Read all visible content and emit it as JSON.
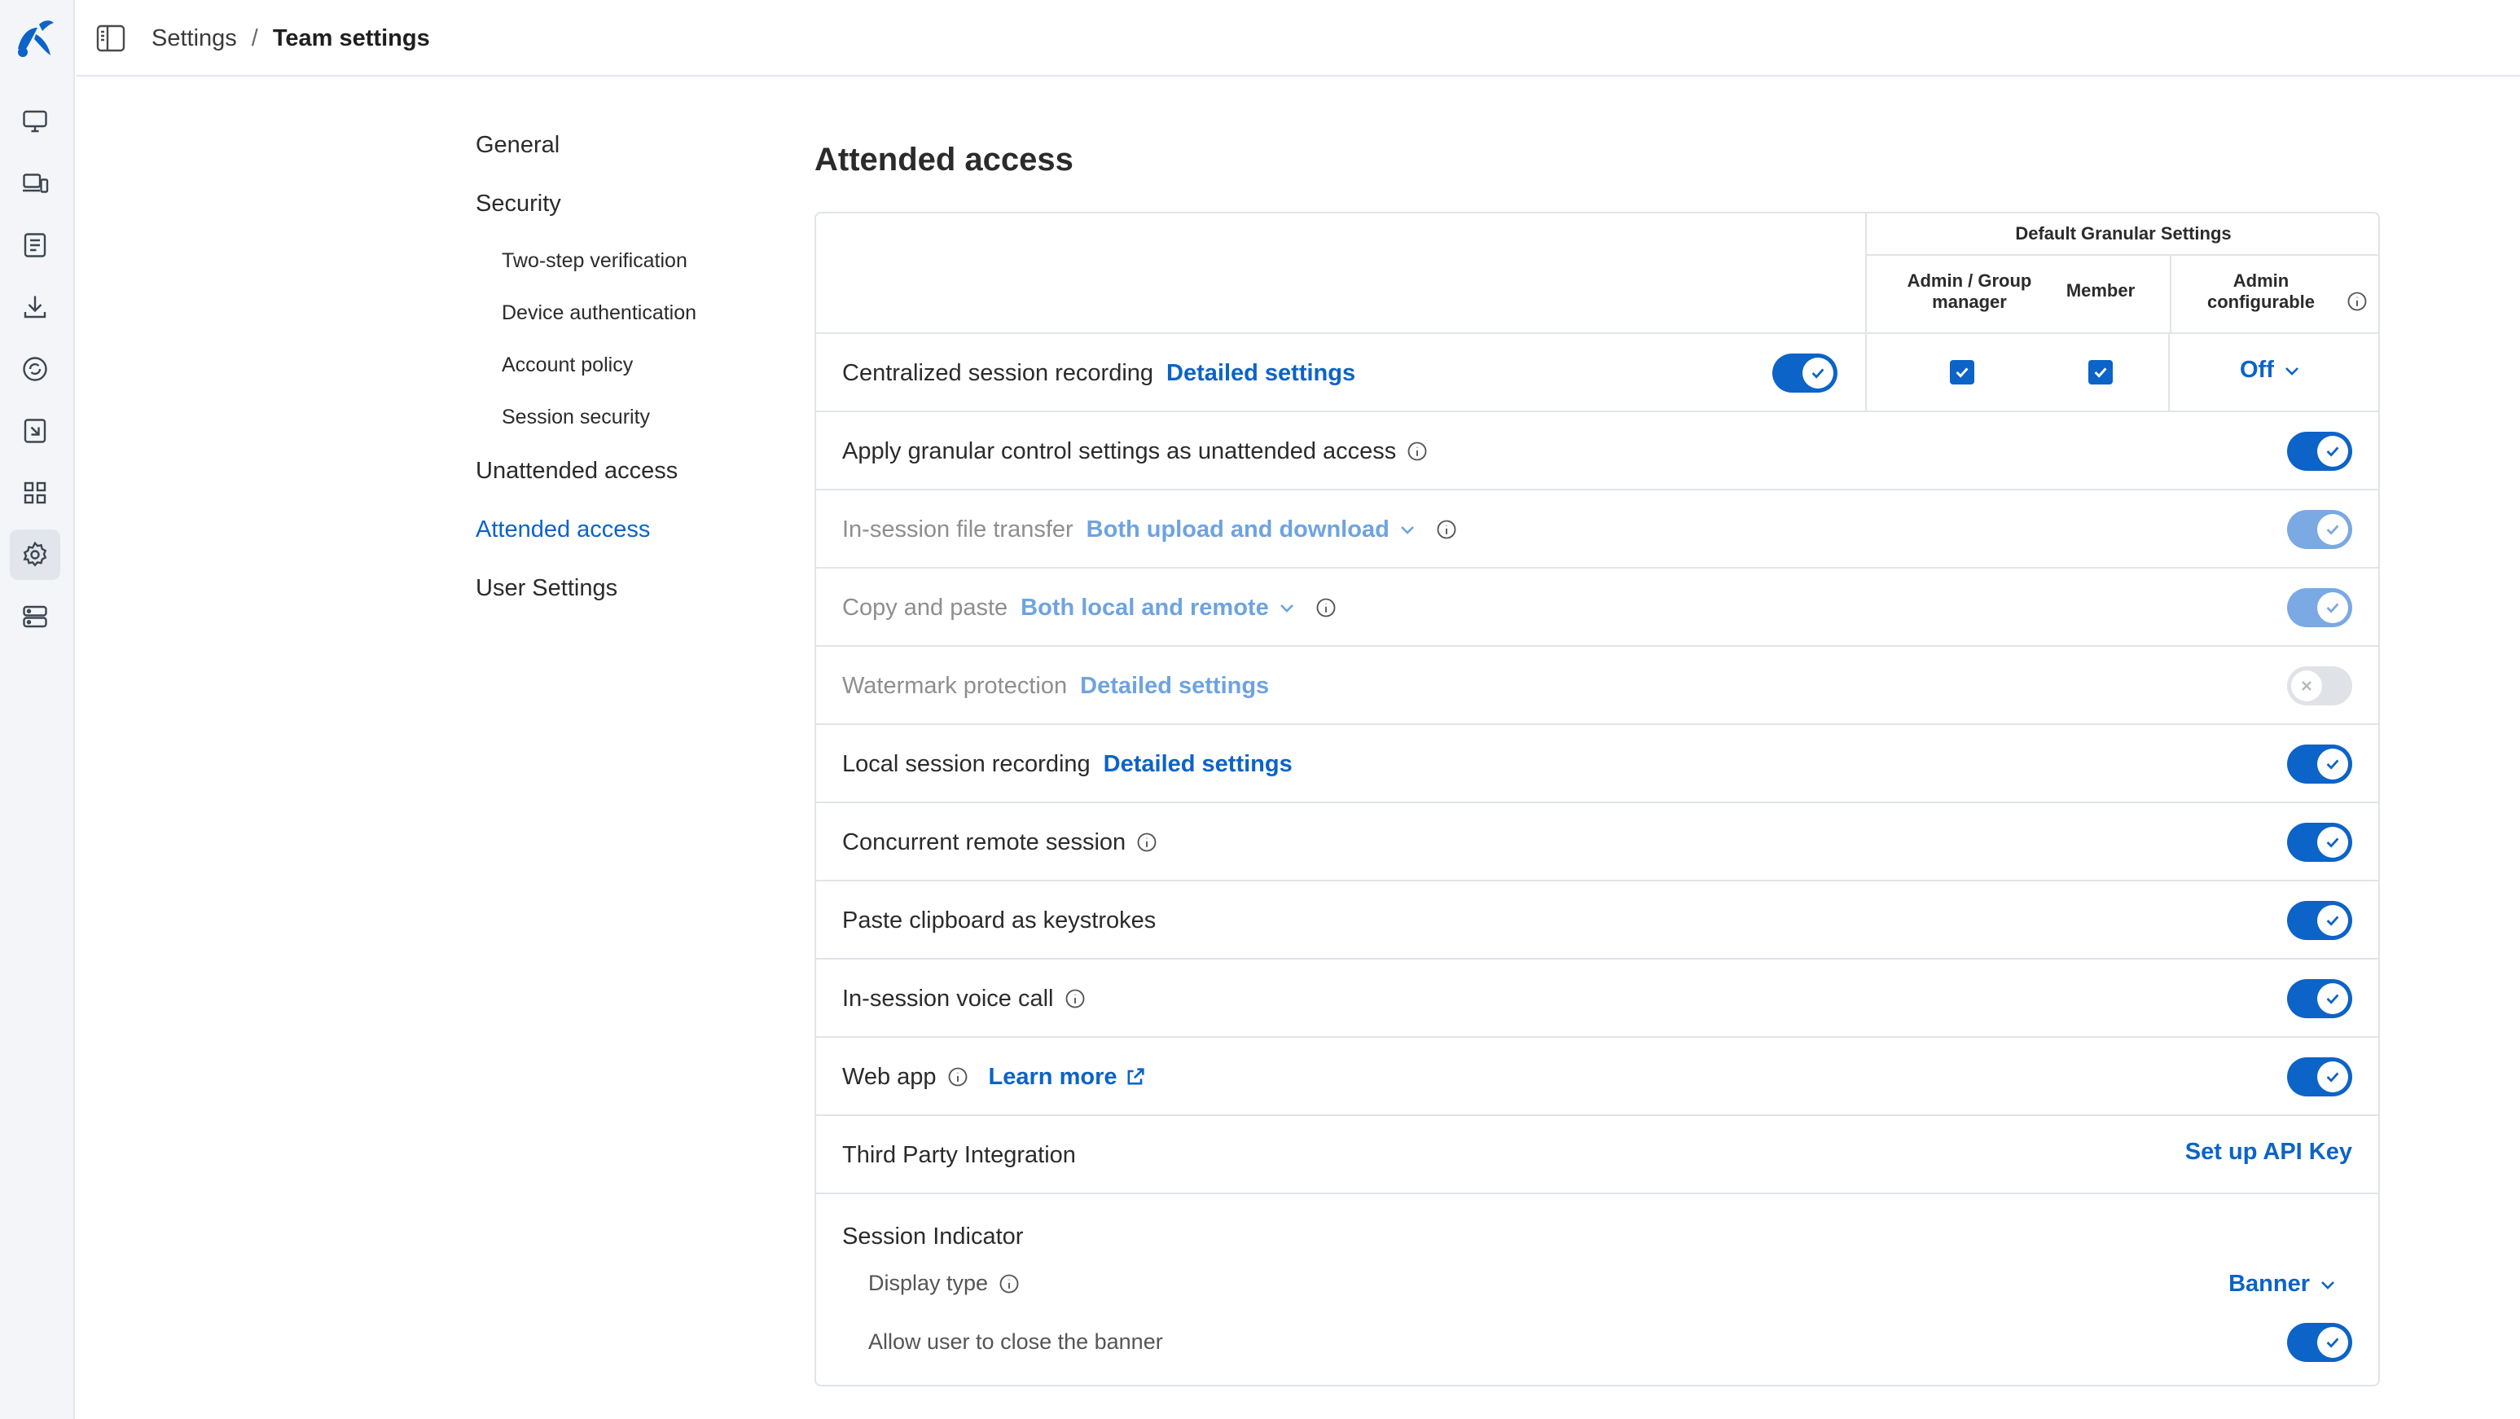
{
  "app": {
    "brand_color": "#0c63c8"
  },
  "rail": {
    "icons": [
      "monitor-icon",
      "devices-icon",
      "document-icon",
      "download-icon",
      "support-icon",
      "remote-file-icon",
      "apps-grid-icon",
      "gear-icon",
      "server-icon"
    ],
    "active": "gear-icon"
  },
  "breadcrumb": {
    "parent": "Settings",
    "separator": "/",
    "current": "Team settings"
  },
  "nav": {
    "general": "General",
    "security": "Security",
    "two_step": "Two-step verification",
    "device_auth": "Device authentication",
    "account_policy": "Account policy",
    "session_security": "Session security",
    "unattended": "Unattended access",
    "attended": "Attended access",
    "user_settings": "User Settings"
  },
  "page": {
    "title": "Attended access"
  },
  "granular": {
    "title": "Default Granular Settings",
    "col_admin": "Admin / Group manager",
    "col_member": "Member",
    "col_admin_cfg": "Admin configurable"
  },
  "rows": {
    "centralized": {
      "label": "Centralized session recording",
      "link": "Detailed settings",
      "enabled": true,
      "admin_checked": true,
      "member_checked": true,
      "admin_cfg_value": "Off"
    },
    "apply_granular": {
      "label": "Apply granular control settings as unattended access",
      "enabled": true
    },
    "file_transfer": {
      "label": "In-session file transfer",
      "option": "Both upload and download",
      "enabled": true
    },
    "copy_paste": {
      "label": "Copy and paste",
      "option": "Both local and remote",
      "enabled": true
    },
    "watermark": {
      "label": "Watermark protection",
      "link": "Detailed settings",
      "enabled": false
    },
    "local_recording": {
      "label": "Local session recording",
      "link": "Detailed settings",
      "enabled": true
    },
    "concurrent": {
      "label": "Concurrent remote session",
      "enabled": true
    },
    "paste_keystrokes": {
      "label": "Paste clipboard as keystrokes",
      "enabled": true
    },
    "voice_call": {
      "label": "In-session voice call",
      "enabled": true
    },
    "web_app": {
      "label": "Web app",
      "link": "Learn more",
      "enabled": true
    },
    "third_party": {
      "label": "Third Party Integration",
      "action": "Set up API Key"
    }
  },
  "session_indicator": {
    "title": "Session Indicator",
    "display_type_label": "Display type",
    "display_type_value": "Banner",
    "close_banner_label": "Allow user to close the banner",
    "close_banner_enabled": true
  }
}
